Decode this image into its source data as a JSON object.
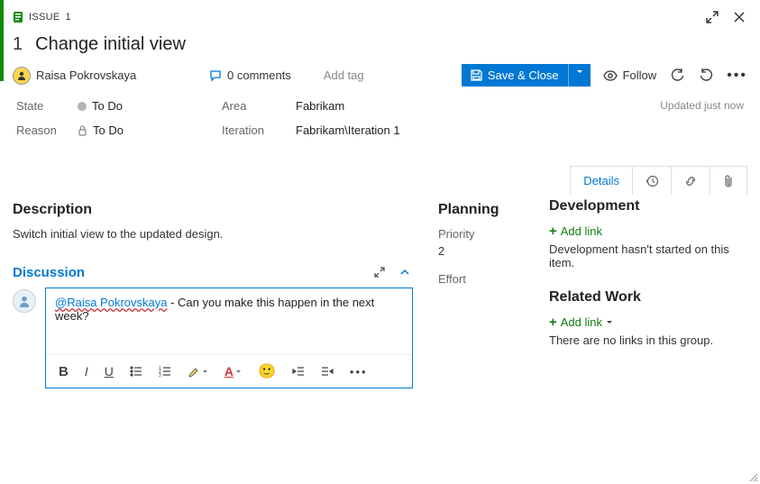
{
  "header": {
    "issue_type": "ISSUE",
    "issue_num_small": "1",
    "id": "1",
    "title": "Change initial view"
  },
  "assignee": {
    "name": "Raisa Pokrovskaya"
  },
  "comments": {
    "count_label": "0 comments"
  },
  "tags": {
    "add_label": "Add tag"
  },
  "actions": {
    "save_close": "Save & Close",
    "follow": "Follow"
  },
  "fields": {
    "state_label": "State",
    "state_value": "To Do",
    "reason_label": "Reason",
    "reason_value": "To Do",
    "area_label": "Area",
    "area_value": "Fabrikam",
    "iteration_label": "Iteration",
    "iteration_value": "Fabrikam\\Iteration 1",
    "updated": "Updated just now"
  },
  "tabs": {
    "details": "Details"
  },
  "description": {
    "heading": "Description",
    "text": "Switch initial view to the updated design."
  },
  "discussion": {
    "heading": "Discussion",
    "mention": "@Raisa Pokrovskaya",
    "text": " - Can you make this happen in the next week?"
  },
  "planning": {
    "heading": "Planning",
    "priority_label": "Priority",
    "priority_value": "2",
    "effort_label": "Effort"
  },
  "development": {
    "heading": "Development",
    "add_link": "Add link",
    "empty": "Development hasn't started on this item."
  },
  "related": {
    "heading": "Related Work",
    "add_link": "Add link",
    "empty": "There are no links in this group."
  }
}
